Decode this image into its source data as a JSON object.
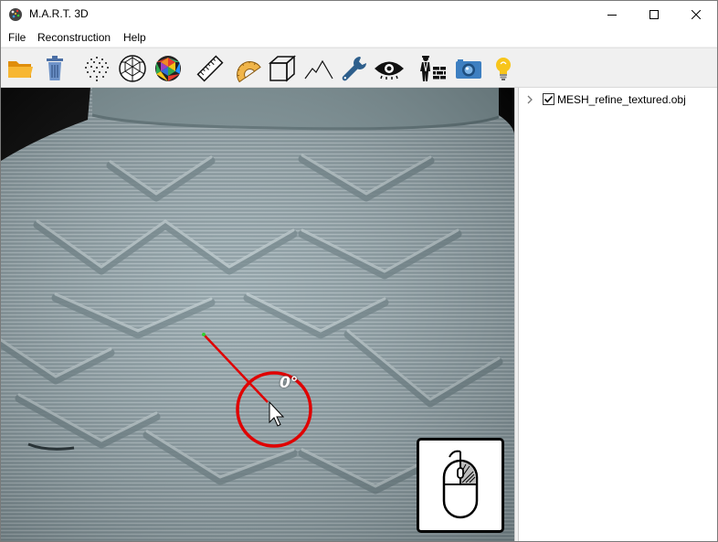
{
  "window": {
    "title": "M.A.R.T. 3D",
    "controls": [
      "minimize",
      "maximize",
      "close"
    ]
  },
  "menu": {
    "items": [
      "File",
      "Reconstruction",
      "Help"
    ]
  },
  "toolbar": {
    "tools": [
      {
        "name": "open-folder-icon",
        "color": "#f5a623"
      },
      {
        "name": "trash-icon",
        "color": "#5b7fb8"
      },
      {
        "name": "point-cloud-icon",
        "color": "#000000"
      },
      {
        "name": "wireframe-sphere-icon",
        "color": "#000000"
      },
      {
        "name": "textured-sphere-icon",
        "color": "#d43b2a"
      },
      {
        "name": "ruler-icon",
        "color": "#000000"
      },
      {
        "name": "protractor-icon",
        "color": "#e8a33c"
      },
      {
        "name": "cube-icon",
        "color": "#000000"
      },
      {
        "name": "mountain-icon",
        "color": "#000000"
      },
      {
        "name": "wrench-icon",
        "color": "#2e5f8c"
      },
      {
        "name": "eye-icon",
        "color": "#000000"
      },
      {
        "name": "worker-wall-icon",
        "color": "#000000"
      },
      {
        "name": "camera-icon",
        "color": "#3d7fc1"
      },
      {
        "name": "lightbulb-icon",
        "color": "#f5c518"
      }
    ]
  },
  "viewport": {
    "angle_label": "0°",
    "mesh_color": "#8fa3a8",
    "measure_line_color": "#e00000",
    "mouse_hint_icon": "mouse-left-button-icon"
  },
  "tree": {
    "items": [
      {
        "label": "MESH_refine_textured.obj",
        "checked": true,
        "expanded": false
      }
    ]
  }
}
